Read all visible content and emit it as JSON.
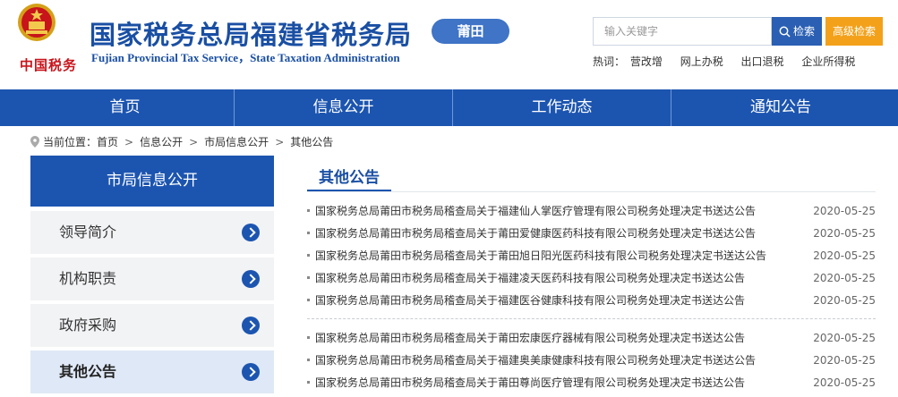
{
  "header": {
    "title": "国家税务总局福建省税务局",
    "subtitle": "Fujian Provincial Tax Service，State Taxation Administration",
    "motto": "中国税务",
    "city": "莆田",
    "colors": {
      "brand": "#1c55b0",
      "accent": "#f3a11a",
      "motto": "#c8141b"
    }
  },
  "search": {
    "placeholder": "输入关键字",
    "button_label": "检索",
    "advanced_label": "高级检索",
    "hot_label": "热词：",
    "hot_terms": [
      "营改增",
      "网上办税",
      "出口退税",
      "企业所得税"
    ]
  },
  "nav": {
    "items": [
      "首页",
      "信息公开",
      "工作动态",
      "通知公告"
    ]
  },
  "breadcrumb": {
    "label": "当前位置：",
    "items": [
      "首页",
      "信息公开",
      "市局信息公开",
      "其他公告"
    ],
    "separator": ">"
  },
  "sidebar": {
    "title": "市局信息公开",
    "items": [
      {
        "label": "领导简介"
      },
      {
        "label": "机构职责"
      },
      {
        "label": "政府采购"
      },
      {
        "label": "其他公告"
      }
    ]
  },
  "main": {
    "title": "其他公告",
    "news": [
      {
        "title": "国家税务总局莆田市税务局稽查局关于福建仙人掌医疗管理有限公司税务处理决定书送达公告",
        "date": "2020-05-25"
      },
      {
        "title": "国家税务总局莆田市税务局稽查局关于莆田爱健康医药科技有限公司税务处理决定书送达公告",
        "date": "2020-05-25"
      },
      {
        "title": "国家税务总局莆田市税务局稽查局关于莆田旭日阳光医药科技有限公司税务处理决定书送达公告",
        "date": "2020-05-25"
      },
      {
        "title": "国家税务总局莆田市税务局稽查局关于福建凌天医药科技有限公司税务处理决定书送达公告",
        "date": "2020-05-25"
      },
      {
        "title": "国家税务总局莆田市税务局稽查局关于福建医谷健康科技有限公司税务处理决定书送达公告",
        "date": "2020-05-25"
      },
      {
        "title": "国家税务总局莆田市税务局稽查局关于莆田宏康医疗器械有限公司税务处理决定书送达公告",
        "date": "2020-05-25"
      },
      {
        "title": "国家税务总局莆田市税务局稽查局关于福建奥美康健康科技有限公司税务处理决定书送达公告",
        "date": "2020-05-25"
      },
      {
        "title": "国家税务总局莆田市税务局稽查局关于莆田尊尚医疗管理有限公司税务处理决定书送达公告",
        "date": "2020-05-25"
      }
    ]
  }
}
